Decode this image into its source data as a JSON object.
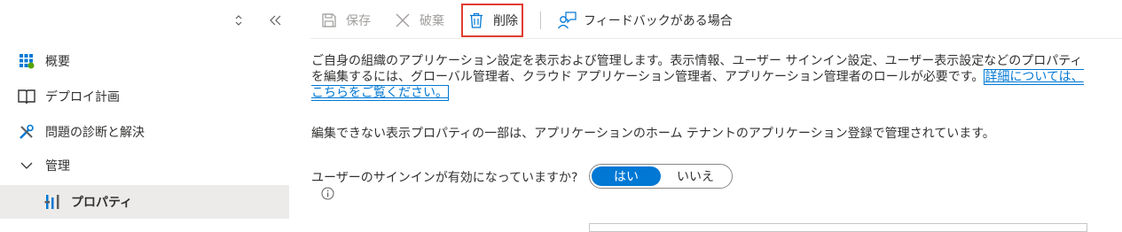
{
  "sidebar": {
    "items": [
      {
        "label": "概要",
        "icon": "overview-grid-icon"
      },
      {
        "label": "デプロイ計画",
        "icon": "book-icon"
      },
      {
        "label": "問題の診断と解決",
        "icon": "tools-icon"
      },
      {
        "label": "管理",
        "icon": "chevron-down-icon"
      },
      {
        "label": "プロパティ",
        "icon": "properties-bars-icon"
      }
    ]
  },
  "toolbar": {
    "save_label": "保存",
    "discard_label": "破棄",
    "delete_label": "削除",
    "feedback_label": "フィードバックがある場合"
  },
  "content": {
    "description_text": "ご自身の組織のアプリケーション設定を表示および管理します。表示情報、ユーザー サインイン設定、ユーザー表示設定などのプロパティを編集するには、グローバル管理者、クラウド アプリケーション管理者、アプリケーション管理者のロールが必要です。",
    "learn_more_link": "詳細については、こちらをご覧ください。",
    "note_text": "編集できない表示プロパティの一部は、アプリケーションのホーム テナントのアプリケーション登録で管理されています。",
    "signin_question": "ユーザーのサインインが有効になっていますか?",
    "toggle_yes": "はい",
    "toggle_no": "いいえ"
  },
  "colors": {
    "accent": "#0078d4",
    "highlight_border": "#e03c31",
    "active_nav_bg": "#edebe9"
  }
}
